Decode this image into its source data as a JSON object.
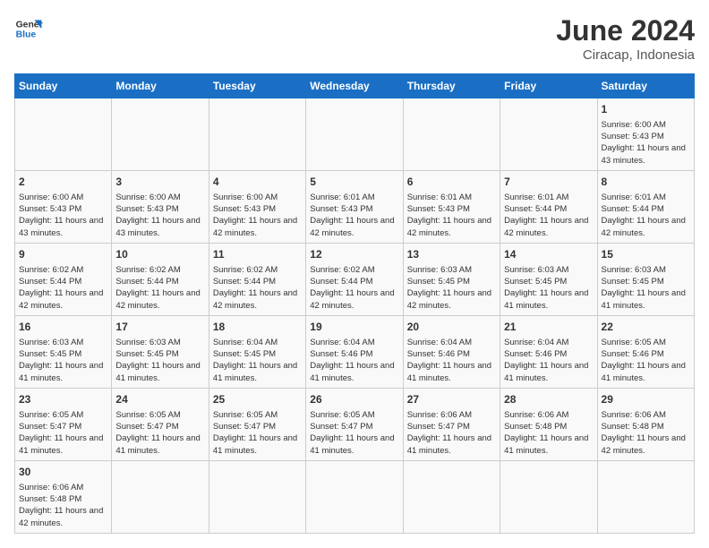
{
  "header": {
    "logo_general": "General",
    "logo_blue": "Blue",
    "month_title": "June 2024",
    "location": "Ciracap, Indonesia"
  },
  "weekdays": [
    "Sunday",
    "Monday",
    "Tuesday",
    "Wednesday",
    "Thursday",
    "Friday",
    "Saturday"
  ],
  "weeks": [
    [
      {
        "day": "",
        "info": ""
      },
      {
        "day": "",
        "info": ""
      },
      {
        "day": "",
        "info": ""
      },
      {
        "day": "",
        "info": ""
      },
      {
        "day": "",
        "info": ""
      },
      {
        "day": "",
        "info": ""
      },
      {
        "day": "1",
        "info": "Sunrise: 6:00 AM\nSunset: 5:43 PM\nDaylight: 11 hours and 43 minutes."
      }
    ],
    [
      {
        "day": "2",
        "info": "Sunrise: 6:00 AM\nSunset: 5:43 PM\nDaylight: 11 hours and 43 minutes."
      },
      {
        "day": "3",
        "info": "Sunrise: 6:00 AM\nSunset: 5:43 PM\nDaylight: 11 hours and 43 minutes."
      },
      {
        "day": "4",
        "info": "Sunrise: 6:00 AM\nSunset: 5:43 PM\nDaylight: 11 hours and 42 minutes."
      },
      {
        "day": "5",
        "info": "Sunrise: 6:01 AM\nSunset: 5:43 PM\nDaylight: 11 hours and 42 minutes."
      },
      {
        "day": "6",
        "info": "Sunrise: 6:01 AM\nSunset: 5:43 PM\nDaylight: 11 hours and 42 minutes."
      },
      {
        "day": "7",
        "info": "Sunrise: 6:01 AM\nSunset: 5:44 PM\nDaylight: 11 hours and 42 minutes."
      },
      {
        "day": "8",
        "info": "Sunrise: 6:01 AM\nSunset: 5:44 PM\nDaylight: 11 hours and 42 minutes."
      }
    ],
    [
      {
        "day": "9",
        "info": "Sunrise: 6:02 AM\nSunset: 5:44 PM\nDaylight: 11 hours and 42 minutes."
      },
      {
        "day": "10",
        "info": "Sunrise: 6:02 AM\nSunset: 5:44 PM\nDaylight: 11 hours and 42 minutes."
      },
      {
        "day": "11",
        "info": "Sunrise: 6:02 AM\nSunset: 5:44 PM\nDaylight: 11 hours and 42 minutes."
      },
      {
        "day": "12",
        "info": "Sunrise: 6:02 AM\nSunset: 5:44 PM\nDaylight: 11 hours and 42 minutes."
      },
      {
        "day": "13",
        "info": "Sunrise: 6:03 AM\nSunset: 5:45 PM\nDaylight: 11 hours and 42 minutes."
      },
      {
        "day": "14",
        "info": "Sunrise: 6:03 AM\nSunset: 5:45 PM\nDaylight: 11 hours and 41 minutes."
      },
      {
        "day": "15",
        "info": "Sunrise: 6:03 AM\nSunset: 5:45 PM\nDaylight: 11 hours and 41 minutes."
      }
    ],
    [
      {
        "day": "16",
        "info": "Sunrise: 6:03 AM\nSunset: 5:45 PM\nDaylight: 11 hours and 41 minutes."
      },
      {
        "day": "17",
        "info": "Sunrise: 6:03 AM\nSunset: 5:45 PM\nDaylight: 11 hours and 41 minutes."
      },
      {
        "day": "18",
        "info": "Sunrise: 6:04 AM\nSunset: 5:45 PM\nDaylight: 11 hours and 41 minutes."
      },
      {
        "day": "19",
        "info": "Sunrise: 6:04 AM\nSunset: 5:46 PM\nDaylight: 11 hours and 41 minutes."
      },
      {
        "day": "20",
        "info": "Sunrise: 6:04 AM\nSunset: 5:46 PM\nDaylight: 11 hours and 41 minutes."
      },
      {
        "day": "21",
        "info": "Sunrise: 6:04 AM\nSunset: 5:46 PM\nDaylight: 11 hours and 41 minutes."
      },
      {
        "day": "22",
        "info": "Sunrise: 6:05 AM\nSunset: 5:46 PM\nDaylight: 11 hours and 41 minutes."
      }
    ],
    [
      {
        "day": "23",
        "info": "Sunrise: 6:05 AM\nSunset: 5:47 PM\nDaylight: 11 hours and 41 minutes."
      },
      {
        "day": "24",
        "info": "Sunrise: 6:05 AM\nSunset: 5:47 PM\nDaylight: 11 hours and 41 minutes."
      },
      {
        "day": "25",
        "info": "Sunrise: 6:05 AM\nSunset: 5:47 PM\nDaylight: 11 hours and 41 minutes."
      },
      {
        "day": "26",
        "info": "Sunrise: 6:05 AM\nSunset: 5:47 PM\nDaylight: 11 hours and 41 minutes."
      },
      {
        "day": "27",
        "info": "Sunrise: 6:06 AM\nSunset: 5:47 PM\nDaylight: 11 hours and 41 minutes."
      },
      {
        "day": "28",
        "info": "Sunrise: 6:06 AM\nSunset: 5:48 PM\nDaylight: 11 hours and 41 minutes."
      },
      {
        "day": "29",
        "info": "Sunrise: 6:06 AM\nSunset: 5:48 PM\nDaylight: 11 hours and 42 minutes."
      }
    ],
    [
      {
        "day": "30",
        "info": "Sunrise: 6:06 AM\nSunset: 5:48 PM\nDaylight: 11 hours and 42 minutes."
      },
      {
        "day": "",
        "info": ""
      },
      {
        "day": "",
        "info": ""
      },
      {
        "day": "",
        "info": ""
      },
      {
        "day": "",
        "info": ""
      },
      {
        "day": "",
        "info": ""
      },
      {
        "day": "",
        "info": ""
      }
    ]
  ]
}
